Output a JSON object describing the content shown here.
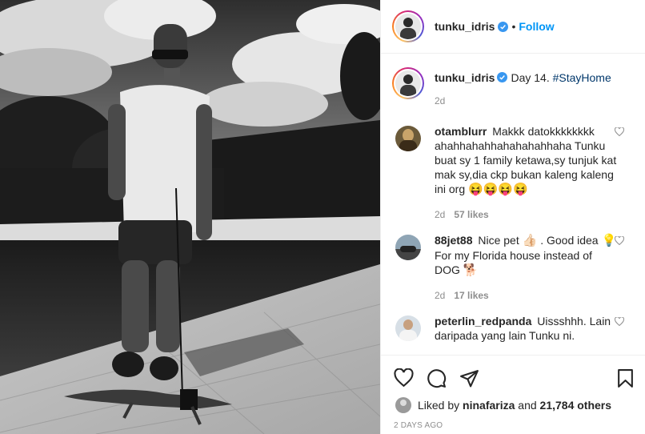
{
  "post": {
    "username": "tunku_idris",
    "follow_label": "Follow",
    "separator": "•",
    "caption_text": "Day 14.",
    "caption_hashtag": "#StayHome",
    "caption_time": "2d"
  },
  "comments": [
    {
      "username": "otamblurr",
      "text": "Makkk datokkkkkkkk ahahhahahhahahahahhaha Tunku buat sy 1 family ketawa,sy tunjuk kat mak sy,dia ckp bukan kaleng kaleng ini org",
      "emoji": "😝😝😝😝",
      "time": "2d",
      "likes": "57 likes"
    },
    {
      "username": "88jet88",
      "text_a": "Nice pet",
      "emoji_a": "👍🏻",
      "text_b": ". Good idea",
      "emoji_b": "💡",
      "text_c": "For my Florida house instead of DOG",
      "emoji_c": "🐕",
      "time": "2d",
      "likes": "17 likes"
    },
    {
      "username": "peterlin_redpanda",
      "text": "Uissshhh. Lain daripada yang lain Tunku ni."
    }
  ],
  "likes": {
    "prefix": "Liked by",
    "user": "ninafariza",
    "and": "and",
    "count": "21,784 others"
  },
  "posted_ago": "2 DAYS AGO",
  "colors": {
    "accent": "#0095f6",
    "text": "#262626",
    "muted": "#8e8e8e",
    "border": "#efefef"
  },
  "icons": [
    "verified-badge-icon",
    "heart-icon",
    "comment-icon",
    "share-icon",
    "bookmark-icon",
    "like-comment-icon"
  ]
}
